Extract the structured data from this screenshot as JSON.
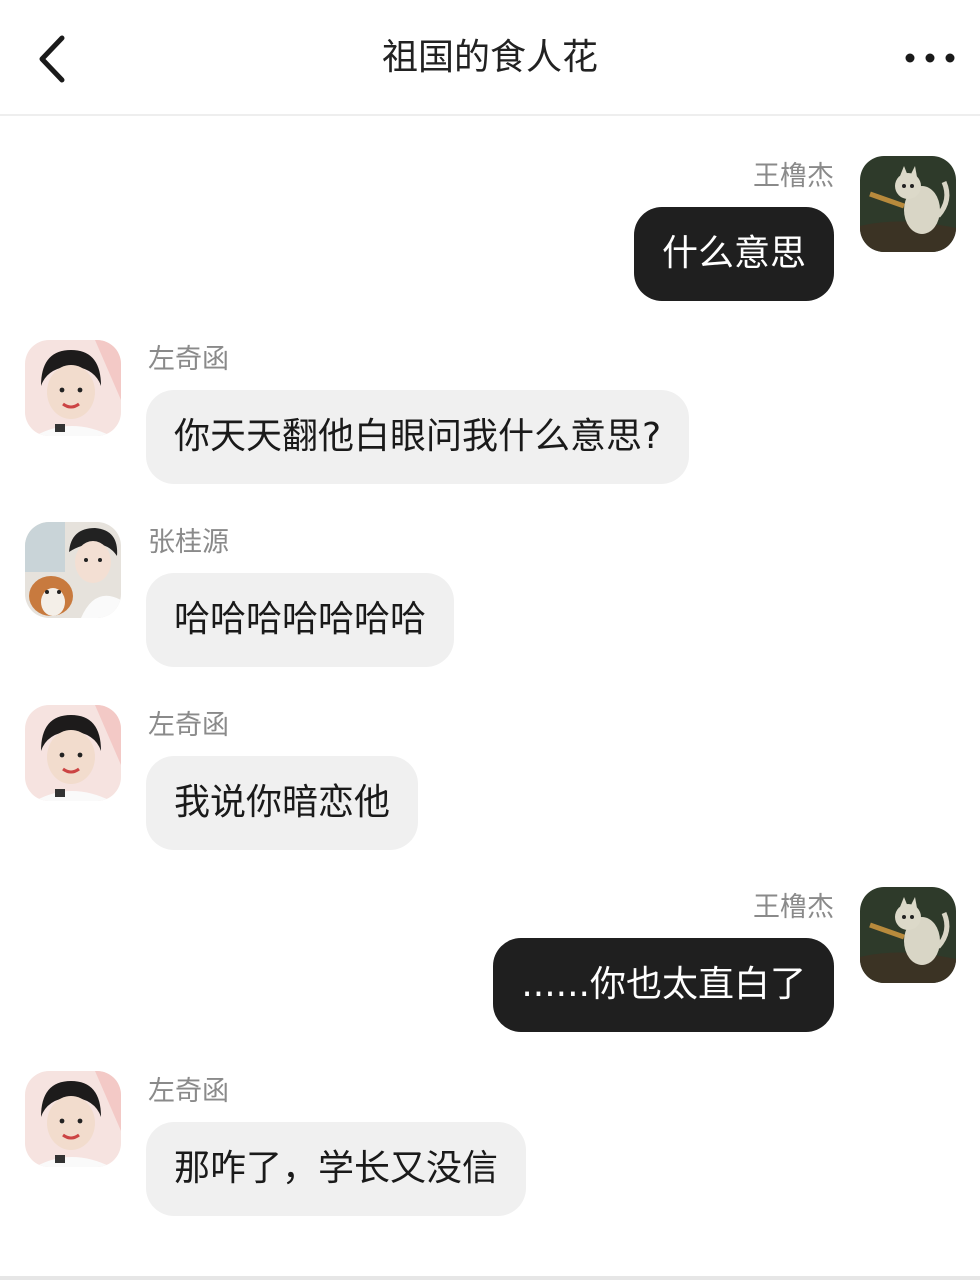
{
  "header": {
    "title": "祖国的食人花",
    "back_icon": "chevron-left-icon",
    "more_icon": "more-dots-icon"
  },
  "messages": [
    {
      "sender": "王橹杰",
      "text": "什么意思",
      "side": "outgoing"
    },
    {
      "sender": "左奇函",
      "text": "你天天翻他白眼问我什么意思?",
      "side": "incoming"
    },
    {
      "sender": "张桂源",
      "text": "哈哈哈哈哈哈哈",
      "side": "incoming"
    },
    {
      "sender": "左奇函",
      "text": "我说你暗恋他",
      "side": "incoming"
    },
    {
      "sender": "王橹杰",
      "text": "......你也太直白了",
      "side": "outgoing"
    },
    {
      "sender": "左奇函",
      "text": "那咋了，学长又没信",
      "side": "incoming"
    }
  ],
  "colors": {
    "outgoing_bubble": "#1f1f1f",
    "incoming_bubble": "#f0f0f0",
    "sender_name": "#8a8a8a"
  }
}
